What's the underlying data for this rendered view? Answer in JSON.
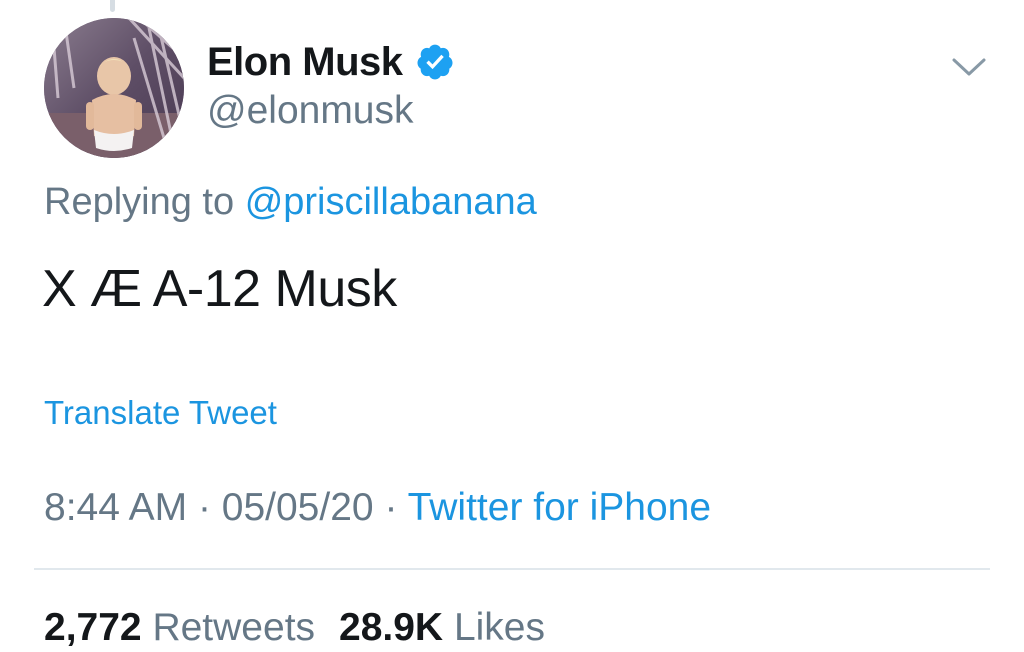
{
  "tweet": {
    "author": {
      "display_name": "Elon Musk",
      "handle": "@elonmusk",
      "verified": true,
      "avatar_icon": "profile-photo-child"
    },
    "replying_prefix": "Replying to",
    "replying_to": "@priscillabanana",
    "text": "X Æ A-12 Musk",
    "translate_label": "Translate Tweet",
    "time": "8:44 AM",
    "separator": "·",
    "date": "05/05/20",
    "source": "Twitter for iPhone",
    "retweets_count": "2,772",
    "retweets_label": "Retweets",
    "likes_count": "28.9K",
    "likes_label": "Likes"
  },
  "colors": {
    "link": "#1b95e0",
    "muted": "#657786",
    "text": "#14171a",
    "verified": "#1da1f2",
    "divider": "#e1e8ed"
  },
  "icons": {
    "verified": "verified-badge-icon",
    "menu": "chevron-down-icon"
  }
}
